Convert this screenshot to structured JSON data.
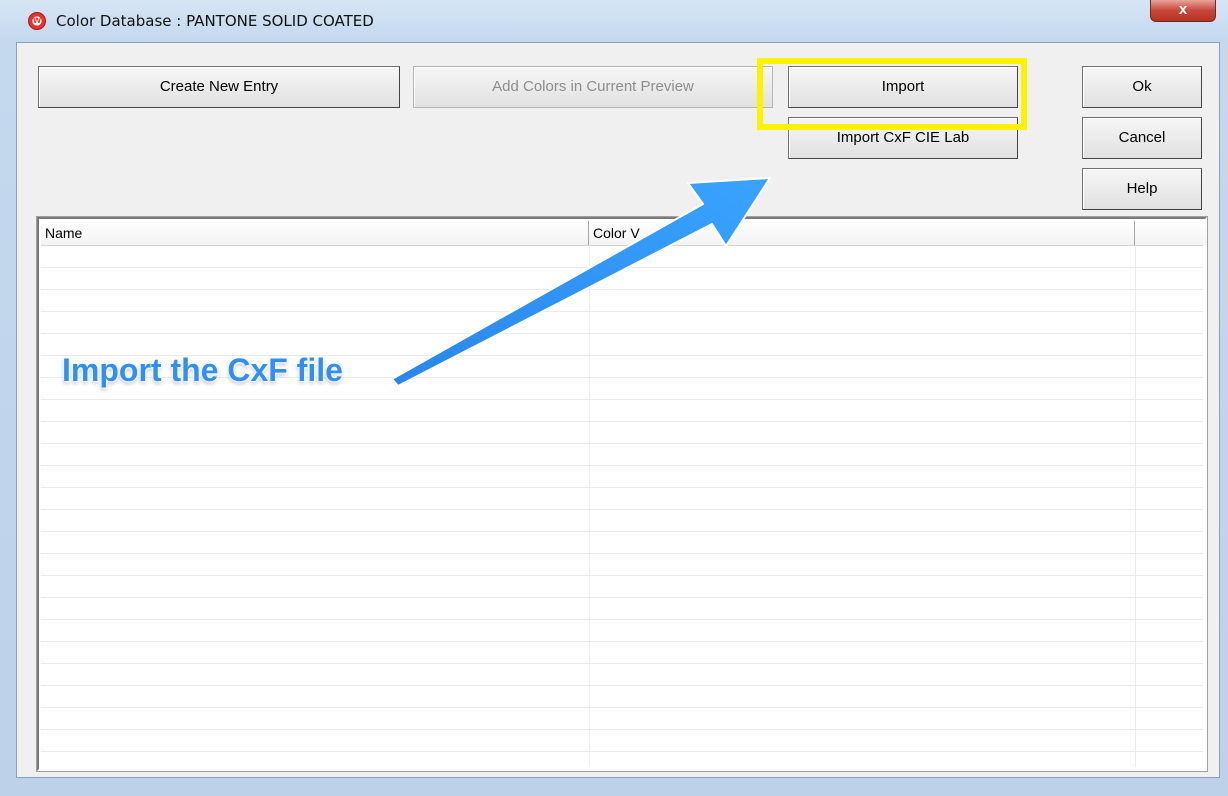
{
  "window": {
    "title": "Color Database : PANTONE SOLID COATED",
    "close_glyph": "x",
    "app_icon": "app-logo-icon"
  },
  "toolbar": {
    "create_new_entry": "Create New Entry",
    "add_colors_in_current_preview": "Add Colors in Current Preview",
    "import": "Import",
    "import_cxf_cie_lab": "Import CxF CIE Lab",
    "ok": "Ok",
    "cancel": "Cancel",
    "help": "Help"
  },
  "table": {
    "columns": [
      "Name",
      "Color V",
      ""
    ]
  },
  "annotation": {
    "text": "Import the CxF file",
    "arrow_color": "#2f8ff2",
    "highlight_color": "#fff200"
  }
}
